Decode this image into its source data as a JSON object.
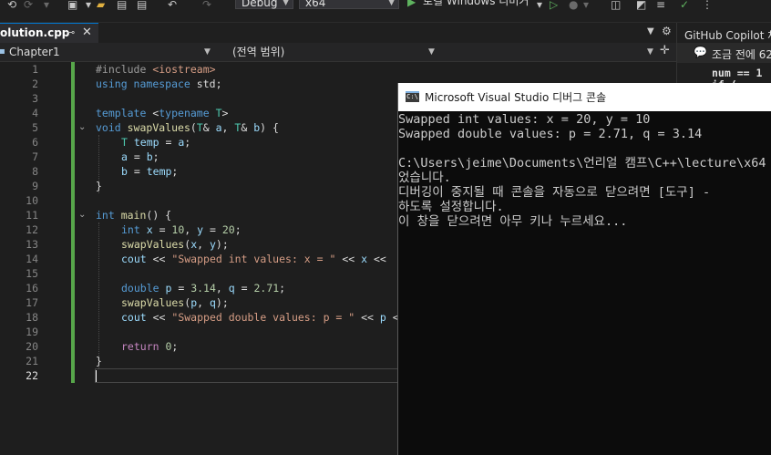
{
  "toolbar": {
    "config": "Debug",
    "platform": "x64",
    "run_label": "로컬 Windows 디버거"
  },
  "tab": {
    "name": "olution.cpp",
    "pin": "⊸",
    "close": "✕"
  },
  "navbar": {
    "project": "Chapter1",
    "scope": "(전역 범위)"
  },
  "line_numbers": [
    "1",
    "2",
    "3",
    "4",
    "5",
    "6",
    "7",
    "8",
    "9",
    "10",
    "11",
    "12",
    "13",
    "14",
    "15",
    "16",
    "17",
    "18",
    "19",
    "20",
    "21",
    "22"
  ],
  "code": {
    "l1_a": "#include ",
    "l1_b": "<iostream>",
    "l2_a": "using",
    "l2_b": " namespace",
    "l2_c": " std;",
    "l4_a": "template",
    "l4_b": " <",
    "l4_c": "typename",
    "l4_d": " T",
    "l4_e": ">",
    "l5_a": "void",
    "l5_b": " swapValues",
    "l5_c": "(",
    "l5_d": "T",
    "l5_e": "& ",
    "l5_f": "a",
    "l5_g": ", ",
    "l5_h": "T",
    "l5_i": "& ",
    "l5_j": "b",
    "l5_k": ") {",
    "l6_a": "T",
    "l6_b": " temp",
    "l6_c": " = ",
    "l6_d": "a",
    "l6_e": ";",
    "l7_a": "a",
    "l7_b": " = ",
    "l7_c": "b",
    "l7_d": ";",
    "l8_a": "b",
    "l8_b": " = ",
    "l8_c": "temp",
    "l8_d": ";",
    "l9": "}",
    "l11_a": "int",
    "l11_b": " main",
    "l11_c": "() {",
    "l12_a": "int",
    "l12_b": " x",
    "l12_c": " = ",
    "l12_d": "10",
    "l12_e": ", ",
    "l12_f": "y",
    "l12_g": " = ",
    "l12_h": "20",
    "l12_i": ";",
    "l13_a": "swapValues",
    "l13_b": "(",
    "l13_c": "x",
    "l13_d": ", ",
    "l13_e": "y",
    "l13_f": ");",
    "l14_a": "cout",
    "l14_b": " << ",
    "l14_c": "\"Swapped int values: x = \"",
    "l14_d": " << ",
    "l14_e": "x",
    "l14_f": " <<",
    "l16_a": "double",
    "l16_b": " p",
    "l16_c": " = ",
    "l16_d": "3.14",
    "l16_e": ", ",
    "l16_f": "q",
    "l16_g": " = ",
    "l16_h": "2.71",
    "l16_i": ";",
    "l17_a": "swapValues",
    "l17_b": "(",
    "l17_c": "p",
    "l17_d": ", ",
    "l17_e": "q",
    "l17_f": ");",
    "l18_a": "cout",
    "l18_b": " << ",
    "l18_c": "\"Swapped double values: p = \"",
    "l18_d": " << ",
    "l18_e": "p",
    "l18_f": " <",
    "l20_a": "return",
    "l20_b": " 0",
    "l20_c": ";",
    "l21": "}"
  },
  "console": {
    "title": "Microsoft Visual Studio 디버그 콘솔",
    "icon_text": "C:\\",
    "lines": [
      "Swapped int values: x = 20, y = 10",
      "Swapped double values: p = 2.71, q = 3.14",
      "",
      "C:\\Users\\jeime\\Documents\\언리얼 캠프\\C++\\lecture\\x64",
      "었습니다.",
      "디버깅이 중지될 때 콘솔을 자동으로 닫으려면 [도구] -",
      "하도록 설정합니다.",
      "이 창을 닫으려면 아무 키나 누르세요..."
    ]
  },
  "copilot": {
    "title": "GitHub Copilot 채",
    "message": "조금 전에 62",
    "code1": "num == 1",
    "code2": "if (",
    "bubble": "💬"
  },
  "colors": {
    "accent": "#0078d4",
    "change_bar": "#57a64a",
    "keyword": "#569cd6",
    "type": "#4ec9b0",
    "function": "#dcdcaa",
    "variable": "#9cdcfe",
    "string": "#d69d85",
    "number": "#b5cea8"
  }
}
